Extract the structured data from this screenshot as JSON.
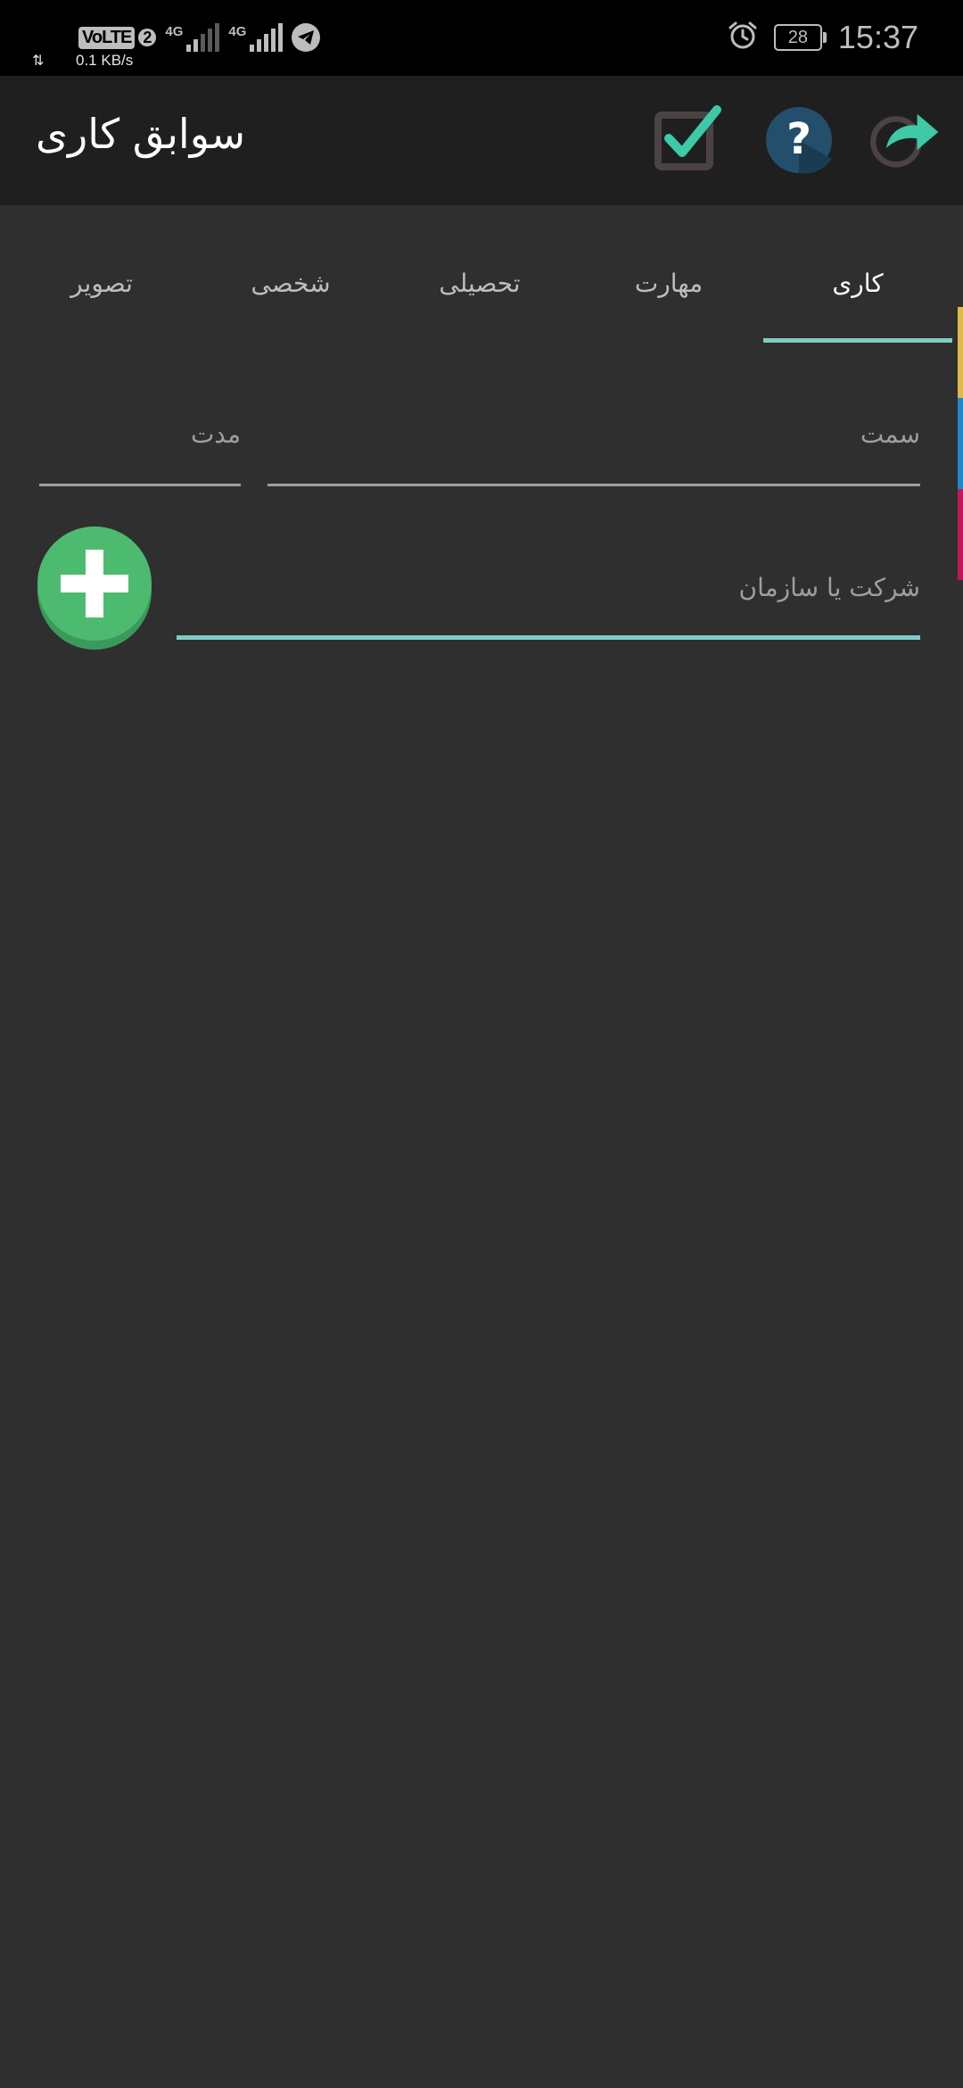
{
  "status_bar": {
    "volte": "VoLTE",
    "volte_sim": "2",
    "network_1": "4G",
    "network_2": "4G",
    "speed": "0.1 KB/s",
    "battery": "28",
    "time": "15:37"
  },
  "app_bar": {
    "title": "سوابق کاری",
    "actions": [
      "confirm-checkbox-icon",
      "help-icon",
      "share-icon"
    ]
  },
  "tabs": {
    "items": [
      {
        "label": "کاری",
        "active": true
      },
      {
        "label": "مهارت",
        "active": false
      },
      {
        "label": "تحصیلی",
        "active": false
      },
      {
        "label": "شخصی",
        "active": false
      },
      {
        "label": "تصویر",
        "active": false
      }
    ]
  },
  "side_strip_colors": [
    "#e0b94c",
    "#1e88c7",
    "#c2185b"
  ],
  "form": {
    "position_placeholder": "سمت",
    "duration_placeholder": "مدت",
    "company_placeholder": "شرکت یا سازمان",
    "position_value": "",
    "duration_value": "",
    "company_value": ""
  },
  "colors": {
    "accent": "#80cbc4",
    "add_button": "#4caf50",
    "background": "#2f2f2f",
    "app_bar": "#1f1f1f"
  }
}
